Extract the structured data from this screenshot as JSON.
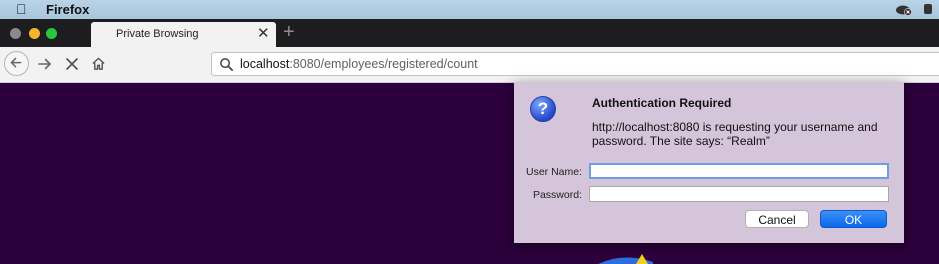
{
  "menubar": {
    "app_name": "Firefox"
  },
  "tabs": [
    {
      "label": "Private Browsing"
    }
  ],
  "navbar": {
    "url_host": "localhost",
    "url_rest": ":8080/employees/registered/count"
  },
  "dialog": {
    "title": "Authentication Required",
    "message": "http://localhost:8080 is requesting your username and password. The site says: “Realm”",
    "username_label": "User Name:",
    "password_label": "Password:",
    "username_value": "",
    "password_value": "",
    "cancel_label": "Cancel",
    "ok_label": "OK"
  },
  "colors": {
    "page_background": "#2c003c",
    "dialog_background": "#d5c5da",
    "ok_button": "#0a68e9",
    "focus_ring": "#6e9de0"
  },
  "icons": [
    "apple-icon",
    "private-browsing-mask-icon",
    "close-icon",
    "plus-icon",
    "back-arrow-icon",
    "forward-arrow-icon",
    "stop-icon",
    "home-icon",
    "search-icon",
    "question-icon"
  ]
}
